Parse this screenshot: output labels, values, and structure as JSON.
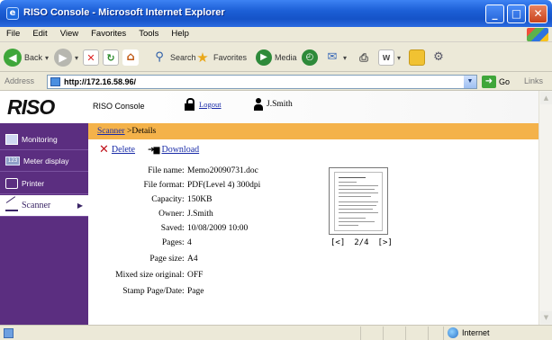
{
  "window": {
    "title": "RISO Console - Microsoft Internet Explorer",
    "buttons": {
      "minimize": "_",
      "maximize": "□",
      "close": "✕"
    }
  },
  "menu": [
    "File",
    "Edit",
    "View",
    "Favorites",
    "Tools",
    "Help"
  ],
  "toolbar": {
    "back_label": "Back",
    "search_label": "Search",
    "favorites_label": "Favorites",
    "media_label": "Media"
  },
  "address": {
    "label": "Address",
    "url": "http://172.16.58.96/",
    "go_label": "Go",
    "links_label": "Links"
  },
  "header": {
    "logo": "RISO",
    "console_label": "RISO Console",
    "logout_label": "Logout",
    "user_name": "J.Smith"
  },
  "sidebar": {
    "items": [
      {
        "label": "Monitoring",
        "icon": "monitor-icon"
      },
      {
        "label": "Meter display",
        "icon": "meter-icon",
        "icon_text": "123"
      },
      {
        "label": "Printer",
        "icon": "printer-icon"
      },
      {
        "label": "Scanner",
        "icon": "scanner-icon",
        "active": true
      }
    ]
  },
  "breadcrumb": {
    "link": "Scanner",
    "current": " >Details"
  },
  "actions": {
    "delete_label": "Delete",
    "download_label": "Download"
  },
  "details": [
    {
      "label": "File name",
      "value": "Memo20090731.doc"
    },
    {
      "label": "File format",
      "value": "PDF(Level 4) 300dpi"
    },
    {
      "label": "Capacity",
      "value": "150KB"
    },
    {
      "label": "Owner",
      "value": "J.Smith"
    },
    {
      "label": "Saved",
      "value": "10/08/2009 10:00"
    },
    {
      "label": "Pages",
      "value": "4"
    },
    {
      "label": "Page size",
      "value": "A4"
    },
    {
      "label": "Mixed size original",
      "value": "OFF"
    },
    {
      "label": "Stamp Page/Date",
      "value": "Page"
    }
  ],
  "pager": {
    "prev": "[<]",
    "current": "2/4",
    "next": "[>]"
  },
  "status": {
    "zone": "Internet"
  },
  "colors": {
    "sidebar": "#5b2e80",
    "breadcrumb_bar": "#f4b24a",
    "link": "#1a2ca8",
    "delete_x": "#c0121b"
  }
}
